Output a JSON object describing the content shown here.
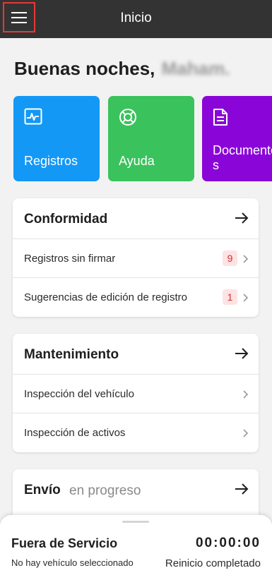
{
  "header": {
    "title": "Inicio",
    "menu_icon": "hamburger-menu-icon"
  },
  "greeting": {
    "text": "Buenas noches,",
    "name": "Maham."
  },
  "tiles": [
    {
      "label": "Registros",
      "icon": "chart-icon",
      "color": "#1398f6"
    },
    {
      "label": "Ayuda",
      "icon": "lifebuoy-icon",
      "color": "#3ac25d"
    },
    {
      "label": "Documentos",
      "icon": "document-icon",
      "color": "#8a06d8"
    }
  ],
  "compliance": {
    "title": "Conformidad",
    "rows": [
      {
        "label": "Registros sin firmar",
        "badge": "9"
      },
      {
        "label": "Sugerencias de edición de registro",
        "badge": "1"
      }
    ]
  },
  "maintenance": {
    "title": "Mantenimiento",
    "rows": [
      {
        "label": "Inspección del vehículo"
      },
      {
        "label": "Inspección de activos"
      }
    ]
  },
  "dispatch": {
    "title": "Envío",
    "subtitle": "en progreso"
  },
  "duty_status": {
    "title": "Fuera de Servicio",
    "vehicle": "No hay vehículo seleccionado",
    "timer": "00:00:00",
    "reset": "Reinicio completado"
  },
  "colors": {
    "badge_bg": "#fde3e3",
    "badge_text": "#d32f2f",
    "topbar": "#333333"
  }
}
